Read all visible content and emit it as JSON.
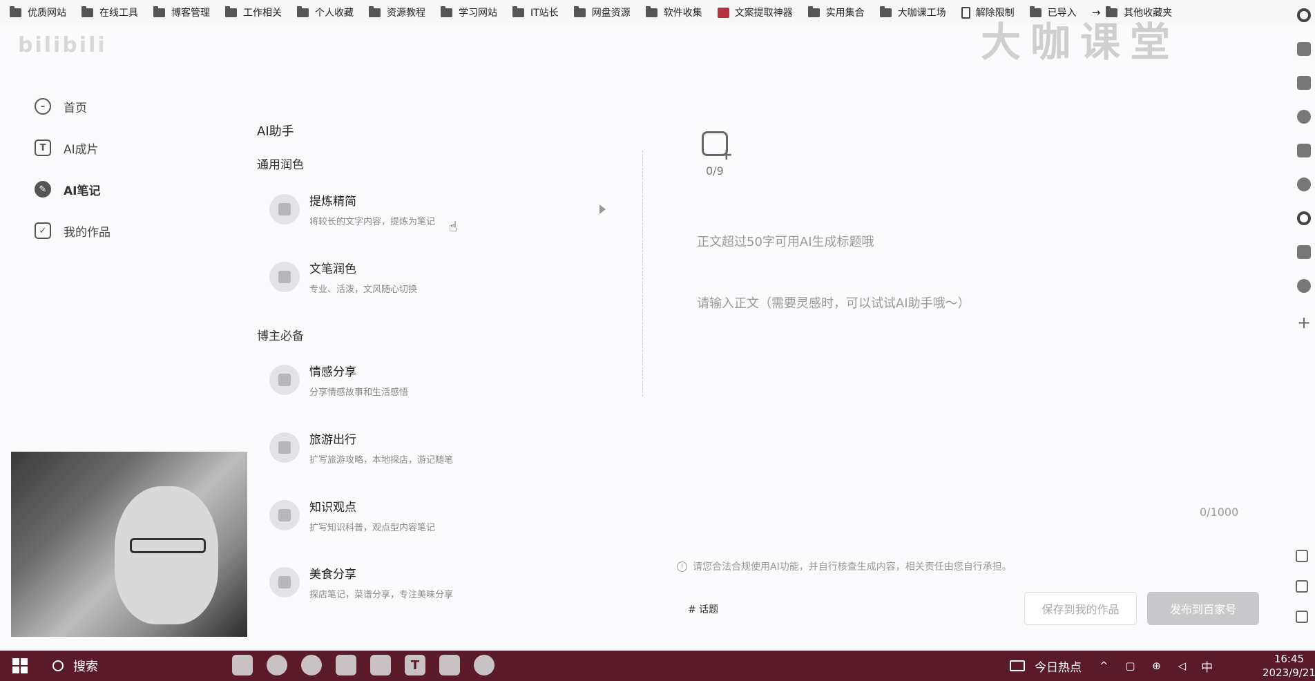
{
  "bookmarks": [
    {
      "label": "优质网站",
      "icon": "folder-icon"
    },
    {
      "label": "在线工具",
      "icon": "folder-icon"
    },
    {
      "label": "博客管理",
      "icon": "folder-icon"
    },
    {
      "label": "工作相关",
      "icon": "folder-icon"
    },
    {
      "label": "个人收藏",
      "icon": "folder-icon"
    },
    {
      "label": "资源教程",
      "icon": "folder-icon"
    },
    {
      "label": "学习网站",
      "icon": "folder-icon"
    },
    {
      "label": "IT站长",
      "icon": "folder-icon"
    },
    {
      "label": "网盘资源",
      "icon": "folder-icon"
    },
    {
      "label": "软件收集",
      "icon": "folder-icon"
    },
    {
      "label": "文案提取神器",
      "icon": "app-icon"
    },
    {
      "label": "实用集合",
      "icon": "folder-icon"
    },
    {
      "label": "大咖课工场",
      "icon": "folder-icon"
    },
    {
      "label": "解除限制",
      "icon": "doc-icon"
    },
    {
      "label": "已导入",
      "icon": "folder-icon"
    },
    {
      "label": "其他收藏夹",
      "icon": "folder-icon"
    }
  ],
  "watermark": "大咖课堂",
  "top_faint": "bilibili",
  "nav": [
    {
      "label": "首页",
      "icon": "home-icon"
    },
    {
      "label": "AI成片",
      "icon": "t-icon"
    },
    {
      "label": "AI笔记",
      "icon": "pen-icon",
      "active": true
    },
    {
      "label": "我的作品",
      "icon": "check-icon"
    }
  ],
  "ai_panel": {
    "title": "AI助手",
    "sections": [
      {
        "title": "通用润色",
        "cards": [
          {
            "title": "提炼精简",
            "desc": "将较长的文字内容，提炼为笔记"
          },
          {
            "title": "文笔润色",
            "desc": "专业、活泼，文风随心切换"
          }
        ]
      },
      {
        "title": "博主必备",
        "cards": [
          {
            "title": "情感分享",
            "desc": "分享情感故事和生活感悟"
          },
          {
            "title": "旅游出行",
            "desc": "扩写旅游攻略，本地探店，游记随笔"
          },
          {
            "title": "知识观点",
            "desc": "扩写知识科普，观点型内容笔记"
          },
          {
            "title": "美食分享",
            "desc": "探店笔记，菜谱分享，专注美味分享"
          }
        ]
      }
    ]
  },
  "editor": {
    "image_count": "0/9",
    "title_placeholder": "正文超过50字可用AI生成标题哦",
    "body_placeholder": "请输入正文（需要灵感时，可以试试AI助手哦～）",
    "char_count": "0/1000",
    "notice": "请您合法合规使用AI功能，并自行核查生成内容，相关责任由您自行承担。",
    "topic": "# 话题",
    "save_label": "保存到我的作品",
    "publish_label": "发布到百家号"
  },
  "taskbar": {
    "search_label": "搜索",
    "news_label": "今日热点",
    "tray": "^ ▢ ⊕ ◁",
    "ime": "中",
    "time": "16:45",
    "date": "2023/9/21",
    "apps": [
      {
        "label": "",
        "icon": "avatar-icon"
      },
      {
        "label": "",
        "icon": "bfta-icon"
      },
      {
        "label": "",
        "icon": "chrome-icon"
      },
      {
        "label": "",
        "icon": "notes-icon"
      },
      {
        "label": "",
        "icon": "tool-icon"
      },
      {
        "label": "T",
        "icon": "typora-icon"
      },
      {
        "label": "",
        "icon": "explorer-icon"
      },
      {
        "label": "",
        "icon": "settings-icon"
      }
    ]
  },
  "colors": {
    "taskbar": "#5a1a2a",
    "publish_button": "#c9c9cc"
  }
}
